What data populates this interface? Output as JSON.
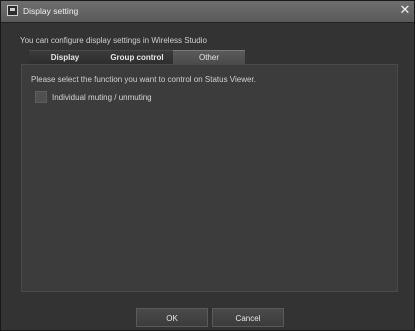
{
  "window": {
    "title": "Display setting",
    "close_glyph": "✕"
  },
  "intro_text": "You can configure  display settings in Wireless Studio",
  "tabs": [
    {
      "label": "Display",
      "active": false
    },
    {
      "label": "Group  control",
      "active": false
    },
    {
      "label": "Other",
      "active": true
    }
  ],
  "panel": {
    "description": "Please select the function  you want to control on Status Viewer.",
    "option": {
      "label": "Individual muting / unmuting",
      "checked": false
    }
  },
  "buttons": {
    "ok": "OK",
    "cancel": "Cancel"
  },
  "colors": {
    "background": "#333333",
    "panel": "#3c3c3c",
    "titlebar": "#6e6e6e"
  }
}
